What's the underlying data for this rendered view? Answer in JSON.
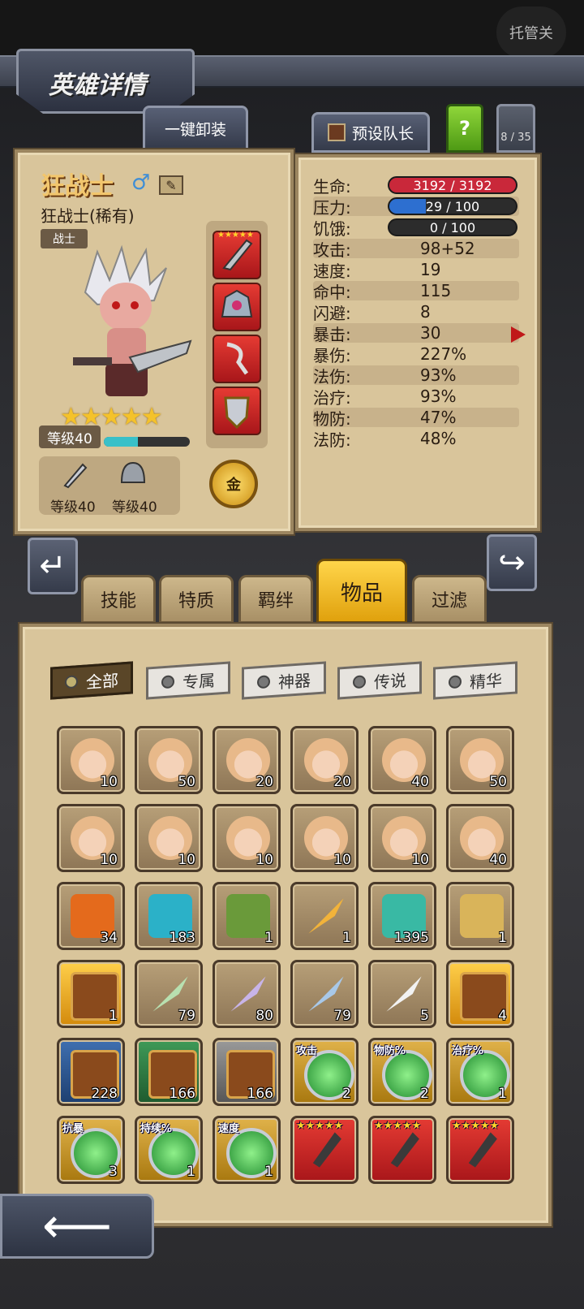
{
  "top": {
    "auto_label": "托管关"
  },
  "header": {
    "title": "英雄详情",
    "unequip_label": "一键卸装",
    "preset_leader_label": "预设队长",
    "help_label": "?",
    "page_counter": "8 / 35"
  },
  "hero": {
    "name": "狂战士",
    "subtitle": "狂战士(稀有)",
    "class": "战士",
    "stars": 5,
    "level_label": "等级40",
    "xp_progress": 0.4,
    "weapon_level": "等级40",
    "armor_level": "等级40",
    "gold_label": "金"
  },
  "stats": [
    {
      "label": "生命:",
      "value": "3192 / 3192",
      "type": "bar",
      "color": "#c9283a",
      "fill": 1.0
    },
    {
      "label": "压力:",
      "value": "29 / 100",
      "type": "bar",
      "color": "#2d6fd0",
      "fill": 0.29
    },
    {
      "label": "饥饿:",
      "value": "0 / 100",
      "type": "bar",
      "color": "#2c2c2c",
      "fill": 0.0
    },
    {
      "label": "攻击:",
      "value": "98+52"
    },
    {
      "label": "速度:",
      "value": "19"
    },
    {
      "label": "命中:",
      "value": "115"
    },
    {
      "label": "闪避:",
      "value": "8"
    },
    {
      "label": "暴击:",
      "value": "30"
    },
    {
      "label": "暴伤:",
      "value": "227%"
    },
    {
      "label": "法伤:",
      "value": "93%"
    },
    {
      "label": "治疗:",
      "value": "93%"
    },
    {
      "label": "物防:",
      "value": "47%"
    },
    {
      "label": "法防:",
      "value": "48%"
    }
  ],
  "tabs": [
    {
      "label": "技能",
      "active": false
    },
    {
      "label": "特质",
      "active": false
    },
    {
      "label": "羁绊",
      "active": false
    },
    {
      "label": "物品",
      "active": true
    },
    {
      "label": "过滤",
      "active": false
    }
  ],
  "filters": [
    {
      "label": "全部",
      "active": true
    },
    {
      "label": "专属",
      "active": false
    },
    {
      "label": "神器",
      "active": false
    },
    {
      "label": "传说",
      "active": false
    },
    {
      "label": "精华",
      "active": false
    }
  ],
  "inventory": [
    [
      {
        "icon": "hero-portrait-orange-hair",
        "count": "10"
      },
      {
        "icon": "hero-portrait-purple-hair",
        "count": "50"
      },
      {
        "icon": "hero-portrait-brown-hair-girl",
        "count": "20"
      },
      {
        "icon": "hero-portrait-silver-hair",
        "count": "20"
      },
      {
        "icon": "hero-portrait-dark-hair-girl",
        "count": "40"
      },
      {
        "icon": "hero-portrait-teal-hair",
        "count": "50"
      }
    ],
    [
      {
        "icon": "hero-portrait-white-hair",
        "count": "10"
      },
      {
        "icon": "hero-portrait-cyan-hair-elf",
        "count": "10"
      },
      {
        "icon": "hero-portrait-orange-twin-tails",
        "count": "10"
      },
      {
        "icon": "hero-portrait-green-hair",
        "count": "10"
      },
      {
        "icon": "hero-portrait-blue-hair-girl",
        "count": "10"
      },
      {
        "icon": "hero-portrait-red-hair",
        "count": "40"
      }
    ],
    [
      {
        "icon": "dice-icon",
        "count": "34"
      },
      {
        "icon": "rune-stone-icon",
        "count": "183"
      },
      {
        "icon": "treasure-box-green-icon",
        "count": "1"
      },
      {
        "icon": "feather-gold-icon",
        "count": "1"
      },
      {
        "icon": "potion-icon",
        "count": "1395"
      },
      {
        "icon": "scroll-icon",
        "count": "1"
      }
    ],
    [
      {
        "icon": "chest-gold-icon",
        "count": "1"
      },
      {
        "icon": "feather-green-icon",
        "count": "79"
      },
      {
        "icon": "feather-purple-icon",
        "count": "80"
      },
      {
        "icon": "feather-blue-icon",
        "count": "79"
      },
      {
        "icon": "feather-white-icon",
        "count": "5"
      },
      {
        "icon": "chest-gold-icon",
        "count": "4"
      }
    ],
    [
      {
        "icon": "chest-blue-icon",
        "count": "228"
      },
      {
        "icon": "chest-green-icon",
        "count": "166"
      },
      {
        "icon": "chest-gray-icon",
        "count": "166"
      },
      {
        "icon": "green-gem-icon",
        "count": "2",
        "tag": "攻击"
      },
      {
        "icon": "green-gem-icon",
        "count": "2",
        "tag": "物防%"
      },
      {
        "icon": "green-gem-icon",
        "count": "1",
        "tag": "治疗%"
      }
    ],
    [
      {
        "icon": "green-gem-icon",
        "count": "3",
        "tag": "抗暴"
      },
      {
        "icon": "green-gem-icon",
        "count": "1",
        "tag": "持续%"
      },
      {
        "icon": "green-gem-icon",
        "count": "1",
        "tag": "速度"
      },
      {
        "icon": "weapon-gauntlet-icon",
        "count": "",
        "stars": "★★★★★"
      },
      {
        "icon": "weapon-pickaxe-icon",
        "count": "",
        "stars": "★★★★★"
      },
      {
        "icon": "weapon-staff-icon",
        "count": "",
        "stars": "★★★★★"
      }
    ]
  ],
  "colors": {
    "parchment": "#d9c59b",
    "gold_tab": "#e0a10d",
    "equip_red": "#c81e24"
  }
}
